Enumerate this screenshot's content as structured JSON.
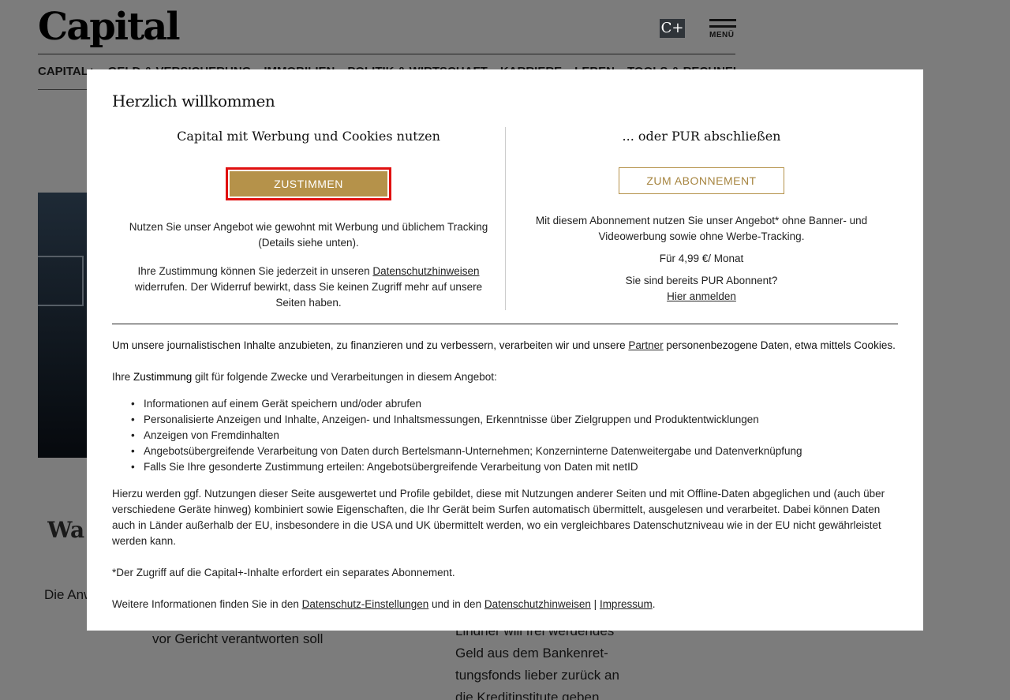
{
  "page": {
    "logo": "Capital",
    "cplus_label": "C+",
    "menu_label": "MENÜ",
    "nav": [
      "CAPITAL+",
      "GELD & VERSICHERUNG",
      "IMMOBILIEN",
      "POLITIK & WIRTSCHAFT",
      "KARRIERE",
      "LEBEN",
      "TOOLS & RECHNER"
    ],
    "teaser1_title": "Wa ni",
    "teaser1_text": "Die Anw teilung",
    "teaser2_text": "vor Gericht verantworten soll",
    "teaser3_text": "Lindner will frei werdendes Geld aus dem Bankenret­tungsfonds lieber zurück an die Kreditinstitute geben"
  },
  "modal": {
    "title": "Herzlich willkommen",
    "left": {
      "heading": "Capital mit Werbung und Cookies nutzen",
      "button": "ZUSTIMMEN",
      "text1": "Nutzen Sie unser Angebot wie gewohnt mit Werbung und üblichem Tracking (Details siehe unten).",
      "text2_pre": "Ihre Zustimmung können Sie jederzeit in unseren ",
      "text2_link": "Datenschutzhinweisen",
      "text2_post": " widerrufen. Der Widerruf bewirkt, dass Sie keinen Zugriff mehr auf unsere Seiten haben."
    },
    "right": {
      "heading": "... oder PUR abschließen",
      "button": "ZUM ABONNEMENT",
      "text1": "Mit diesem Abonnement nutzen Sie unser Angebot* ohne Banner- und Videowerbung sowie ohne Werbe-Tracking.",
      "price": "Für 4,99 €/ Monat",
      "already": "Sie sind bereits PUR Abonnent?",
      "login_link": "Hier anmelden"
    },
    "intro_pre": "Um unsere journalistischen Inhalte anzubieten, zu finanzieren und zu verbessern, verarbeiten wir und unsere ",
    "intro_link": "Partner",
    "intro_post": " personenbezogene Daten, etwa mittels Cookies.",
    "purposes_pre": "Ihre ",
    "purposes_strong": "Zustimmung",
    "purposes_post": " gilt für folgende Zwecke und Verarbeitungen in diesem Angebot:",
    "purposes": [
      "Informationen auf einem Gerät speichern und/oder abrufen",
      "Personalisierte Anzeigen und Inhalte, Anzeigen- und Inhaltsmessungen, Erkenntnisse über Zielgruppen und Produktentwicklungen",
      "Anzeigen von Fremdinhalten",
      "Angebotsübergreifende Verarbeitung von Daten durch Bertelsmann-Unternehmen; Konzerninterne Datenweitergabe und Datenverknüpfung",
      "Falls Sie Ihre gesonderte Zustimmung erteilen: Angebotsübergreifende Verarbeitung von Daten mit netID"
    ],
    "hierzu": "Hierzu werden ggf. Nutzungen dieser Seite ausgewertet und Profile gebildet, diese mit Nutzungen anderer Seiten und mit Offline-Daten abgeglichen und (auch über verschiedene Geräte hinweg) kombiniert sowie Eigenschaften, die Ihr Gerät beim Surfen automatisch übermittelt, ausgelesen und verarbeitet. Dabei können Daten auch in Länder außerhalb der EU, insbesondere in die USA und UK übermittelt werden, wo ein vergleichbares Datenschutzniveau wie in der EU nicht gewährleistet werden kann.",
    "capplus_note": "*Der Zugriff auf die Capital+-Inhalte erfordert ein separates Abonnement.",
    "weitere_pre": "Weitere Informationen finden Sie in den ",
    "weitere_link1": "Datenschutz-Einstellungen",
    "weitere_mid": " und in den ",
    "weitere_link2": "Datenschutzhinweisen",
    "weitere_sep": " | ",
    "weitere_link3": "Impressum",
    "weitere_end": "."
  }
}
